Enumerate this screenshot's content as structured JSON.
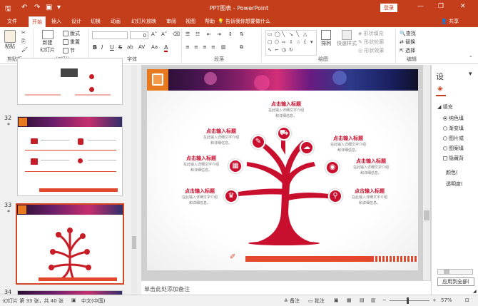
{
  "window": {
    "title": "PPT图表 - PowerPoint",
    "login_label": "登录",
    "minimize": "—",
    "restore": "❐",
    "close": "✕"
  },
  "quick_access": {
    "save": "🖫",
    "undo": "↶",
    "redo": "↷",
    "present": "▣",
    "more": "▾"
  },
  "tabs": [
    {
      "label": "文件"
    },
    {
      "label": "开始"
    },
    {
      "label": "插入"
    },
    {
      "label": "设计"
    },
    {
      "label": "切换"
    },
    {
      "label": "动画"
    },
    {
      "label": "幻灯片放映"
    },
    {
      "label": "审阅"
    },
    {
      "label": "视图"
    },
    {
      "label": "帮助"
    }
  ],
  "tellme": "告诉我你想要做什么",
  "share": "共享",
  "ribbon": {
    "clipboard": {
      "paste": "粘贴",
      "group": "剪贴板"
    },
    "slides": {
      "new_slide": "新建",
      "new_slide2": "幻灯片",
      "layout": "版式",
      "reset": "重置",
      "section": "节",
      "group": "幻灯片"
    },
    "font": {
      "group": "字体",
      "font_size": "0"
    },
    "paragraph": {
      "group": "段落"
    },
    "drawing": {
      "arrange": "排列",
      "quick_styles": "快速样式",
      "fill": "形状填充",
      "outline": "形状轮廓",
      "effects": "形状效果",
      "group": "绘图"
    },
    "editing": {
      "find": "查找",
      "replace": "替换",
      "select": "选择",
      "group": "编辑"
    },
    "format_row": [
      "B",
      "I",
      "U",
      "S",
      "ab",
      "AV",
      "Aa",
      "A"
    ]
  },
  "thumbnails": [
    {
      "number": "",
      "star": ""
    },
    {
      "number": "32",
      "star": "*"
    },
    {
      "number": "33",
      "star": "*"
    },
    {
      "number": "34",
      "star": ""
    }
  ],
  "slide": {
    "center_title": "点击输入标题",
    "center_sub1": "在此输入详细文字介绍",
    "center_sub2": "和详细信息。",
    "branches": [
      {
        "title": "点击输入标题",
        "sub1": "在此输入详细文字介绍",
        "sub2": "和详细信息。"
      },
      {
        "title": "点击输入标题",
        "sub1": "在此输入详细文字介绍",
        "sub2": "和详细信息。"
      },
      {
        "title": "点击输入标题",
        "sub1": "在此输入详细文字介绍",
        "sub2": "和详细信息。"
      },
      {
        "title": "点击输入标题",
        "sub1": "在此输入详细文字介绍",
        "sub2": "和详细信息。"
      },
      {
        "title": "点击输入标题",
        "sub1": "在此输入详细文字介绍",
        "sub2": "和详细信息。"
      },
      {
        "title": "点击输入标题",
        "sub1": "在此输入详细文字介绍",
        "sub2": "和详细信息。"
      }
    ]
  },
  "notes_placeholder": "单击此处添加备注",
  "pane": {
    "title": "设",
    "section": "填充",
    "options": [
      "纯色填",
      "渐变填",
      "图片或",
      "图案填",
      "隐藏背"
    ],
    "color_label": "颜色(",
    "transparency_label": "透明度(",
    "apply_all": "应用到全部(",
    "collapse": "◢"
  },
  "status": {
    "slide_info": "幻灯片 第 33 张，共 40 张",
    "language": "中文(中国)",
    "notes": "备注",
    "comments": "批注",
    "zoom": "57%",
    "minus": "−",
    "plus": "+"
  },
  "colors": {
    "accent": "#c43e1c",
    "tree": "#c8102e",
    "selected_border": "#d24726"
  }
}
